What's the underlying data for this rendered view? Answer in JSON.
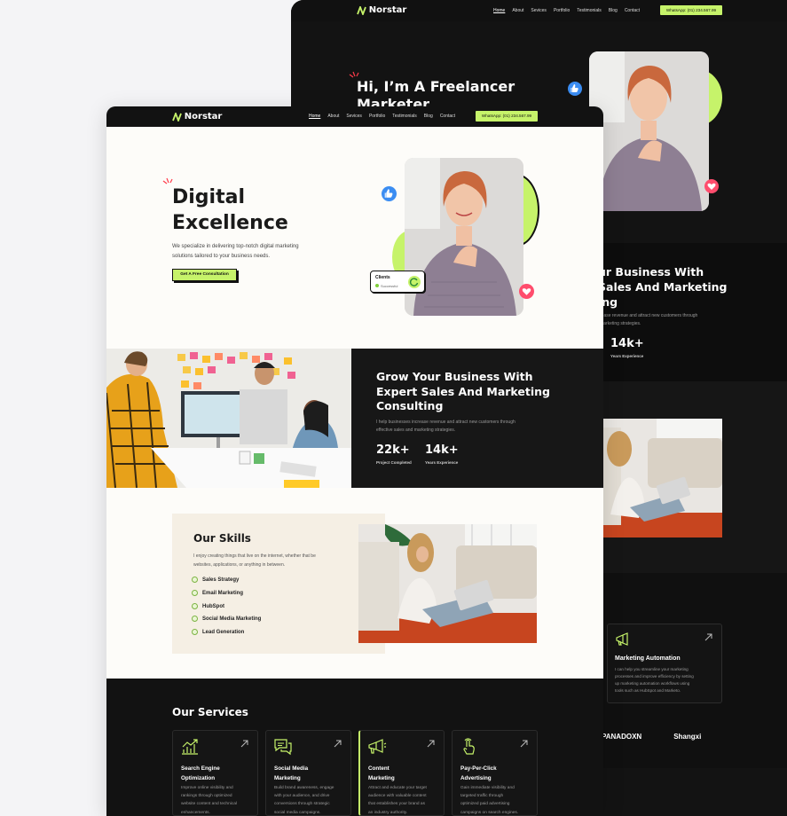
{
  "colors": {
    "accent": "#c6f36a",
    "dark": "#121212",
    "like": "#3b8df2",
    "heart": "#ff4d6d",
    "cream": "#fdfcf9",
    "skills_bg": "#f5efe4"
  },
  "brand": {
    "name": "Norstar"
  },
  "nav": {
    "items": [
      "Home",
      "About",
      "Sevices",
      "Portfolio",
      "Testimonials",
      "Blog",
      "Contact"
    ],
    "whatsapp": "WhatsApp: (01) 234.567.99"
  },
  "back": {
    "hero_title_1": "Hi, I’m A Freelancer",
    "hero_title_2": "Marketer",
    "band_title": [
      "ur Business With",
      "Sales And Marketing",
      "ing"
    ],
    "band_text": [
      "rease revenue and attract new customers through",
      "marketing strategies."
    ],
    "stat_value": "14k+",
    "stat_label": "Years Experience",
    "service_card": {
      "title": "Marketing Automation",
      "desc": [
        "I can help you streamline your marketing",
        "processes and improve efficiency by setting",
        "up marketing automation workflows using",
        "tools such as HubSpot and Marketo."
      ]
    },
    "brands": [
      "PANADOXN",
      "Shangxi"
    ]
  },
  "hero": {
    "title_1": "Digital",
    "title_2": "Excellence",
    "desc_1": "We specialize in delivering top-notch digital marketing",
    "desc_2": "solutions tailored to your business needs.",
    "cta": "Get A Free Consultation",
    "clients_label": "Clients",
    "clients_status": "Successful"
  },
  "grow": {
    "title": [
      "Grow Your Business With",
      "Expert Sales And Marketing",
      "Consulting"
    ],
    "text": [
      "I help businesses increase revenue and attract new customers through",
      "effective sales and marketing strategies."
    ],
    "stats": [
      {
        "value": "22k+",
        "label": "Project Completed"
      },
      {
        "value": "14k+",
        "label": "Years Experience"
      }
    ]
  },
  "skills": {
    "title": "Our Skills",
    "text": [
      "I enjoy creating things that live on the internet, whether that be",
      "websites, applications, or anything in between."
    ],
    "items": [
      "Sales Strategy",
      "Email Marketing",
      "HubSpot",
      "Social Media Marketing",
      "Lead Generation"
    ]
  },
  "services": {
    "title": "Our Services",
    "cards": [
      {
        "icon": "chart-growth-icon",
        "title": [
          "Search Engine",
          "Optimization"
        ],
        "desc": [
          "Improve online visibility and",
          "rankings through optimized",
          "website content and technical",
          "enhancements."
        ]
      },
      {
        "icon": "chat-bubbles-icon",
        "title": [
          "Social Media",
          "Marketing"
        ],
        "desc": [
          "Build brand awareness, engage",
          "with your audience, and drive",
          "conversions through strategic",
          "social media campaigns."
        ]
      },
      {
        "icon": "megaphone-icon",
        "title": [
          "Content",
          "Marketing"
        ],
        "desc": [
          "Attract and educate your target",
          "audience with valuable content",
          "that establishes your brand as",
          "an industry authority."
        ]
      },
      {
        "icon": "pointer-hand-icon",
        "title": [
          "Pay-Per-Click",
          "Advertising"
        ],
        "desc": [
          "Gain immediate visibility and",
          "targeted traffic through",
          "optimized paid advertising",
          "campaigns on search engines."
        ]
      }
    ]
  }
}
